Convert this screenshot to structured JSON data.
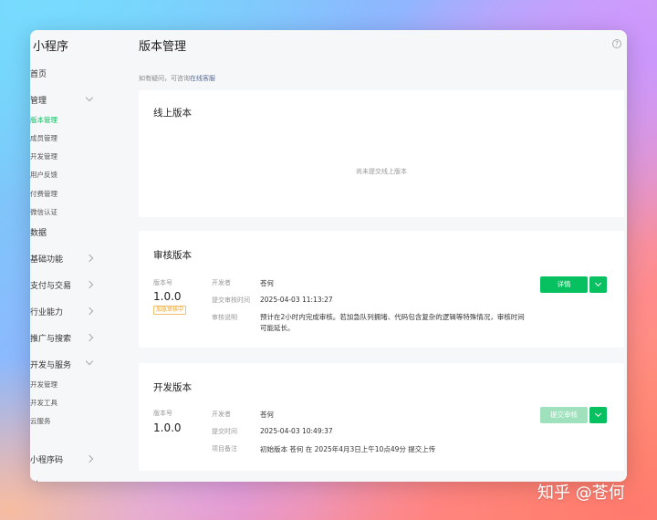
{
  "app": {
    "title": "小程序"
  },
  "sidebar": {
    "items": [
      {
        "label": "首页"
      },
      {
        "label": "管理"
      },
      {
        "label": "版本管理"
      },
      {
        "label": "成员管理"
      },
      {
        "label": "开发管理"
      },
      {
        "label": "用户反馈"
      },
      {
        "label": "付费管理"
      },
      {
        "label": "微信认证"
      },
      {
        "label": "数据"
      },
      {
        "label": "基础功能"
      },
      {
        "label": "支付与交易"
      },
      {
        "label": "行业能力"
      },
      {
        "label": "推广与搜索"
      },
      {
        "label": "开发与服务"
      },
      {
        "label": "开发管理"
      },
      {
        "label": "开发工具"
      },
      {
        "label": "云服务"
      },
      {
        "label": "小程序码"
      },
      {
        "label": "…"
      }
    ]
  },
  "header": {
    "title": "版本管理",
    "help_icon": "?"
  },
  "notice": {
    "text": "如有疑问，可咨询",
    "link": "在线客服"
  },
  "online": {
    "title": "线上版本",
    "empty": "尚未提交线上版本"
  },
  "review": {
    "title": "审核版本",
    "version_label": "版本号",
    "version": "1.0.0",
    "status": "加急审核中",
    "developer_label": "开发者",
    "developer": "苍何",
    "time_label": "提交审核时间",
    "time": "2025-04-03 11:13:27",
    "note_label": "审核说明",
    "note": "预计在2小时内完成审核。若加急队列拥堵、代码包含复杂的逻辑等特殊情况，审核时间可能延长。",
    "detail_button": "详情"
  },
  "dev": {
    "title": "开发版本",
    "version_label": "版本号",
    "version": "1.0.0",
    "developer_label": "开发者",
    "developer": "苍何",
    "time_label": "提交时间",
    "time": "2025-04-03 10:49:37",
    "remark_label": "项目备注",
    "remark": "初始版本 苍何 在 2025年4月3日上午10点49分 提交上传",
    "submit_button": "提交审核"
  },
  "watermark": "知乎 @苍何",
  "colors": {
    "accent": "#07c160",
    "link": "#576b95",
    "badge": "#f0a020"
  }
}
